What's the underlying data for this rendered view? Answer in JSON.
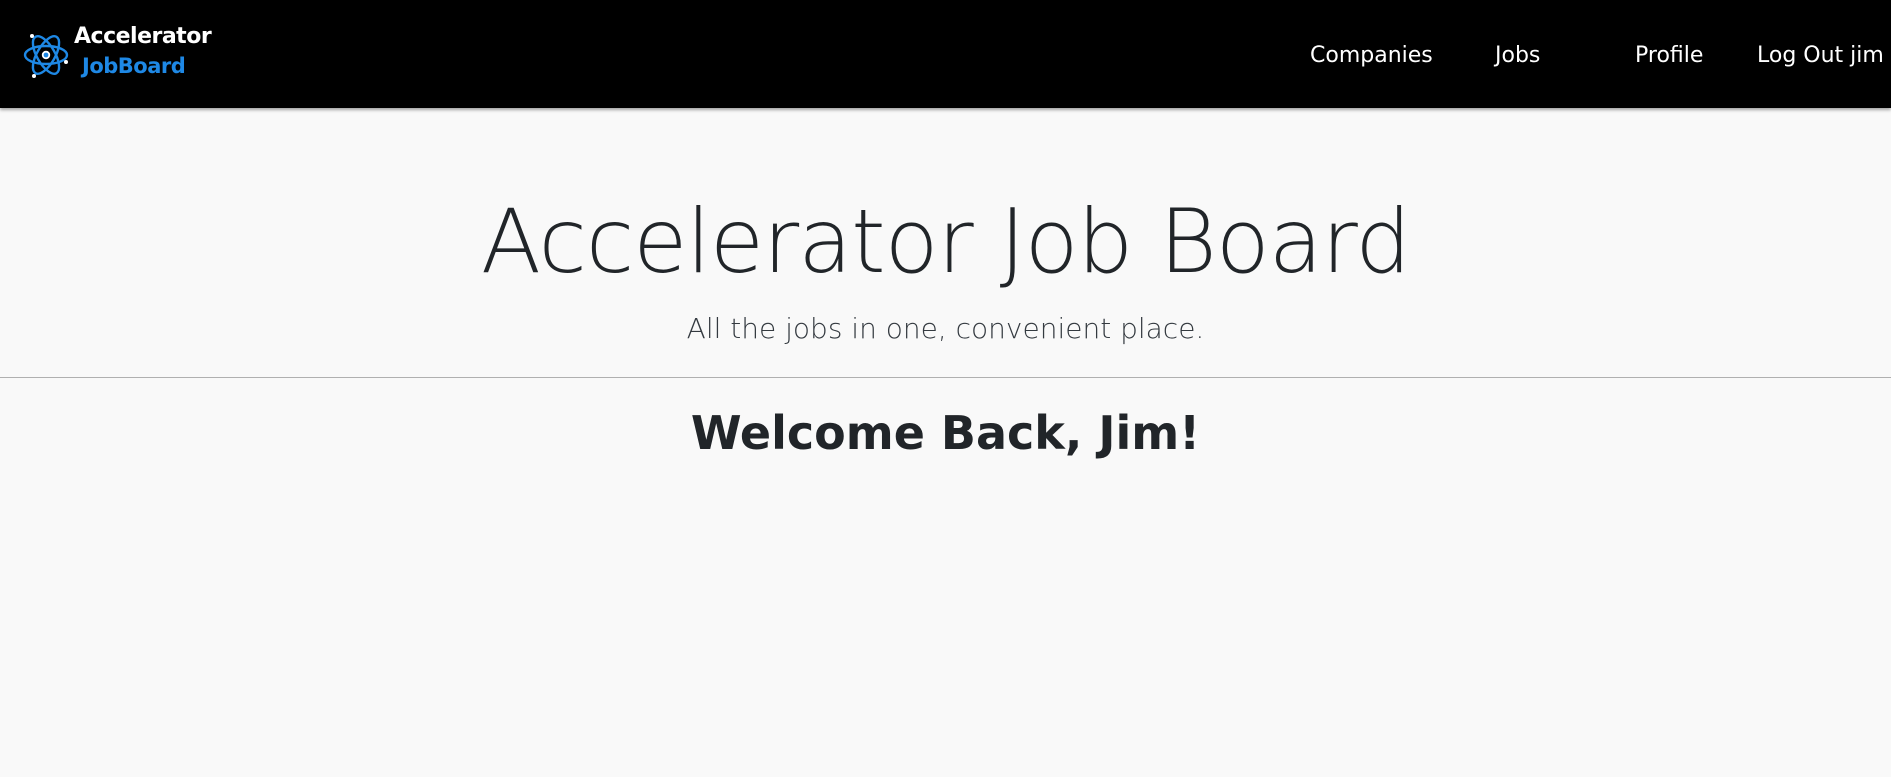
{
  "brand": {
    "line1": "Accelerator",
    "line2": "JobBoard",
    "logo_icon": "atom-icon",
    "accent_color": "#1e88e5"
  },
  "nav": {
    "companies": "Companies",
    "jobs": "Jobs",
    "profile": "Profile",
    "logout": "Log Out jim"
  },
  "hero": {
    "title": "Accelerator Job Board",
    "lead": "All the jobs in one, convenient place."
  },
  "main": {
    "welcome": "Welcome Back, Jim!"
  },
  "colors": {
    "navbar_background": "#000000",
    "page_background": "#f9f9f9",
    "text": "#212529"
  }
}
